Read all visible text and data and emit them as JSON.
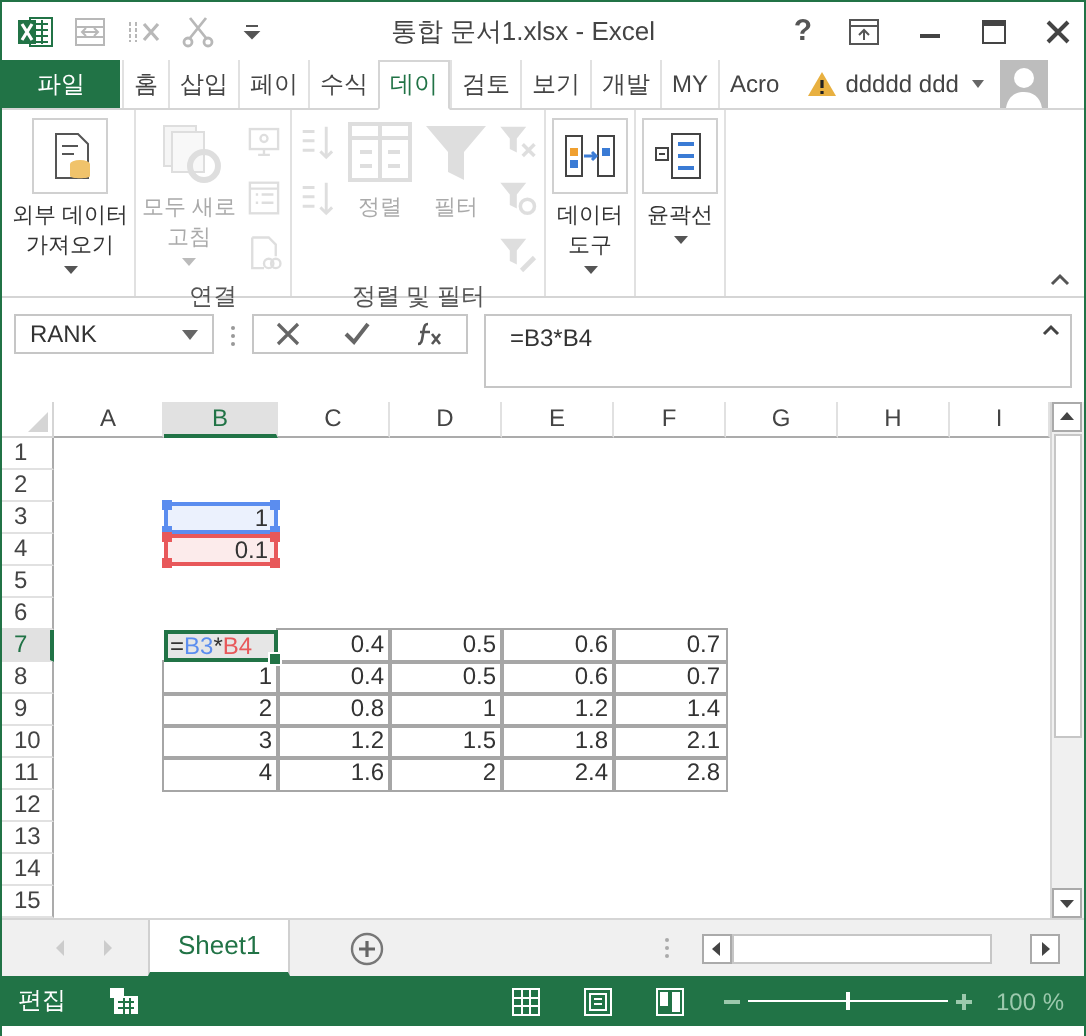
{
  "title_bar": {
    "title": "통합 문서1.xlsx - Excel",
    "help": "?",
    "quick_access": [
      {
        "kind": "form",
        "disabled": true
      },
      {
        "kind": "cut-col",
        "disabled": true
      },
      {
        "kind": "scissors",
        "disabled": true
      },
      {
        "kind": "customize",
        "disabled": false
      }
    ]
  },
  "tabs": [
    {
      "label": "파일",
      "kind": "file",
      "selected": false
    },
    {
      "label": "홈",
      "kind": "tab",
      "selected": false
    },
    {
      "label": "삽입",
      "kind": "tab",
      "selected": false
    },
    {
      "label": "페이",
      "kind": "tab",
      "selected": false
    },
    {
      "label": "수식",
      "kind": "tab",
      "selected": false
    },
    {
      "label": "데이",
      "kind": "tab",
      "selected": true
    },
    {
      "label": "검토",
      "kind": "tab",
      "selected": false
    },
    {
      "label": "보기",
      "kind": "tab",
      "selected": false
    },
    {
      "label": "개발",
      "kind": "tab",
      "selected": false
    },
    {
      "label": "MY",
      "kind": "tab",
      "selected": false
    },
    {
      "label": "Acro",
      "kind": "tab",
      "selected": false
    }
  ],
  "account": {
    "name": "ddddd ddd",
    "warning": true
  },
  "ribbon": {
    "groups": [
      {
        "columns": [
          [
            {
              "kind": "import",
              "lines": [
                "외부 데이터",
                "가져오기"
              ],
              "dropdown": true,
              "disabled": false
            }
          ]
        ]
      },
      {
        "label": "연결",
        "columns": [
          [
            {
              "kind": "refresh",
              "lines": [
                "모두 새로",
                "고침"
              ],
              "dropdown": true,
              "disabled": true
            }
          ],
          [
            {
              "kind": "connections",
              "disabled": true
            },
            {
              "kind": "properties",
              "disabled": true
            },
            {
              "kind": "edit-links",
              "disabled": true
            }
          ]
        ]
      },
      {
        "label": "정렬 및 필터",
        "columns": [
          [
            {
              "kind": "sort-asc",
              "disabled": true
            },
            {
              "kind": "sort-desc",
              "disabled": true
            }
          ],
          [
            {
              "kind": "sort",
              "lines": [
                "정렬"
              ],
              "disabled": true
            }
          ],
          [
            {
              "kind": "filter",
              "lines": [
                "필터"
              ],
              "disabled": true
            }
          ],
          [
            {
              "kind": "clear",
              "disabled": true
            },
            {
              "kind": "reapply",
              "disabled": true
            },
            {
              "kind": "advanced",
              "disabled": true
            }
          ]
        ]
      },
      {
        "columns": [
          [
            {
              "kind": "data-tools",
              "lines": [
                "데이터",
                "도구"
              ],
              "dropdown": true,
              "disabled": false
            }
          ]
        ]
      },
      {
        "columns": [
          [
            {
              "kind": "outline",
              "lines": [
                "윤곽선"
              ],
              "dropdown": true,
              "disabled": false
            }
          ]
        ]
      }
    ]
  },
  "formula_bar": {
    "name_box": "RANK",
    "formula": "=B3*B4"
  },
  "sheet": {
    "columns": [
      {
        "label": "A",
        "selected": false
      },
      {
        "label": "B",
        "selected": true
      },
      {
        "label": "C",
        "selected": false
      },
      {
        "label": "D",
        "selected": false
      },
      {
        "label": "E",
        "selected": false
      },
      {
        "label": "F",
        "selected": false
      },
      {
        "label": "G",
        "selected": false
      },
      {
        "label": "H",
        "selected": false
      },
      {
        "label": "I",
        "selected": false
      }
    ],
    "rows": [
      {
        "number": "1",
        "selected": false
      },
      {
        "number": "2",
        "selected": false
      },
      {
        "number": "3",
        "selected": false,
        "cells": [
          null,
          {
            "text": "1",
            "kind": "reference",
            "color": "#5b8def"
          }
        ]
      },
      {
        "number": "4",
        "selected": false,
        "cells": [
          null,
          {
            "text": "0.1",
            "kind": "reference",
            "color": "#e8585a"
          }
        ]
      },
      {
        "number": "5",
        "selected": false
      },
      {
        "number": "6",
        "selected": false
      },
      {
        "number": "7",
        "selected": true,
        "cells": [
          null,
          {
            "kind": "editing",
            "bordered": true,
            "tokens": [
              {
                "text": "="
              },
              {
                "text": "B3",
                "color": "#5b8def"
              },
              {
                "text": "*"
              },
              {
                "text": "B4",
                "color": "#e8585a"
              }
            ]
          },
          {
            "text": "0.4",
            "bordered": true
          },
          {
            "text": "0.5",
            "bordered": true
          },
          {
            "text": "0.6",
            "bordered": true
          },
          {
            "text": "0.7",
            "bordered": true
          }
        ]
      },
      {
        "number": "8",
        "selected": false,
        "cells": [
          null,
          {
            "text": "1",
            "bordered": true
          },
          {
            "text": "0.4",
            "bordered": true
          },
          {
            "text": "0.5",
            "bordered": true
          },
          {
            "text": "0.6",
            "bordered": true
          },
          {
            "text": "0.7",
            "bordered": true
          }
        ]
      },
      {
        "number": "9",
        "selected": false,
        "cells": [
          null,
          {
            "text": "2",
            "bordered": true
          },
          {
            "text": "0.8",
            "bordered": true
          },
          {
            "text": "1",
            "bordered": true
          },
          {
            "text": "1.2",
            "bordered": true
          },
          {
            "text": "1.4",
            "bordered": true
          }
        ]
      },
      {
        "number": "10",
        "selected": false,
        "cells": [
          null,
          {
            "text": "3",
            "bordered": true
          },
          {
            "text": "1.2",
            "bordered": true
          },
          {
            "text": "1.5",
            "bordered": true
          },
          {
            "text": "1.8",
            "bordered": true
          },
          {
            "text": "2.1",
            "bordered": true
          }
        ]
      },
      {
        "number": "11",
        "selected": false,
        "cells": [
          null,
          {
            "text": "4",
            "bordered": true
          },
          {
            "text": "1.6",
            "bordered": true
          },
          {
            "text": "2",
            "bordered": true
          },
          {
            "text": "2.4",
            "bordered": true
          },
          {
            "text": "2.8",
            "bordered": true
          }
        ]
      },
      {
        "number": "12",
        "selected": false
      },
      {
        "number": "13",
        "selected": false
      },
      {
        "number": "14",
        "selected": false
      },
      {
        "number": "15",
        "selected": false
      }
    ]
  },
  "sheet_tabs": [
    {
      "label": "Sheet1",
      "selected": true
    }
  ],
  "status_bar": {
    "mode": "편집",
    "zoom": "100 %",
    "zoom_slider": {
      "level": 0.5
    }
  }
}
